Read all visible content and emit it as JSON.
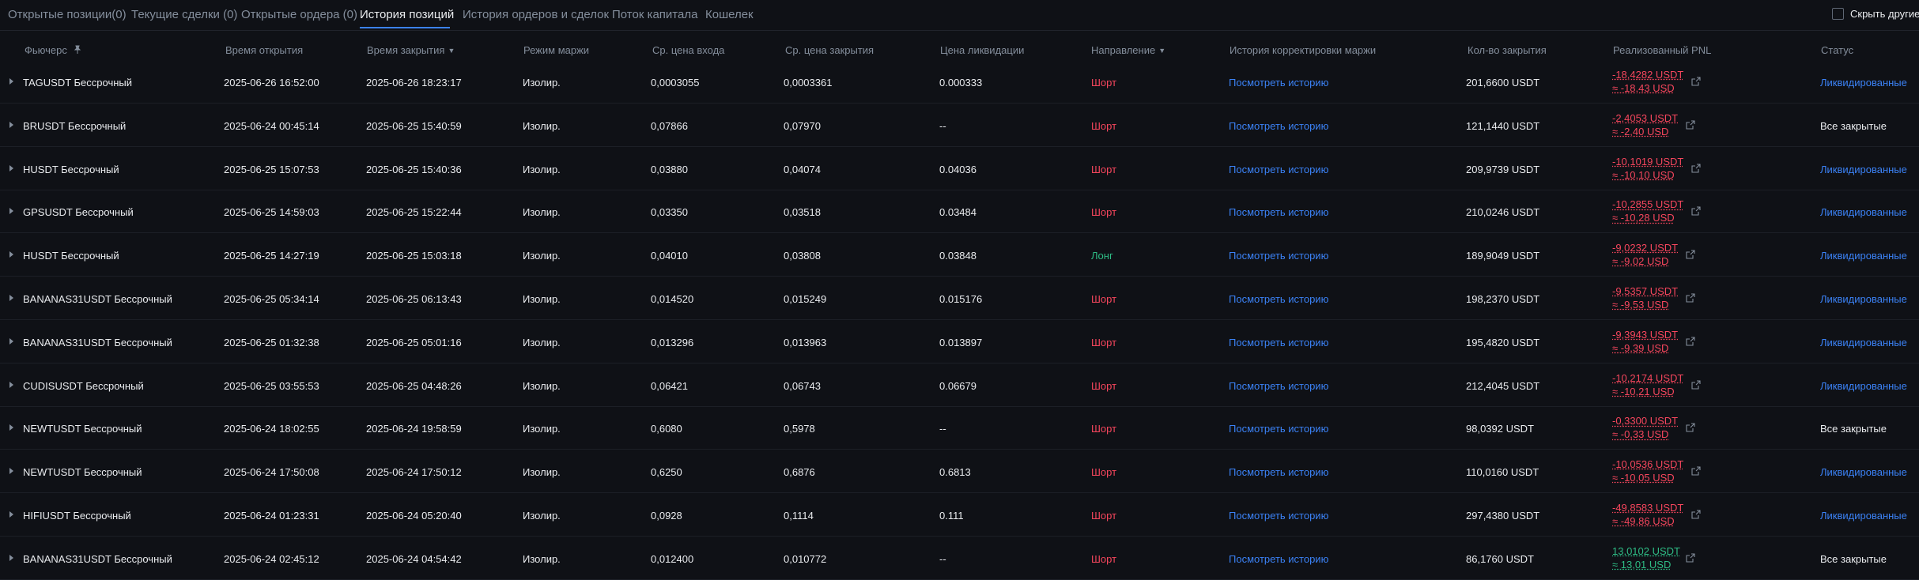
{
  "tabs": [
    {
      "label": "Открытые позиции(0)",
      "active": false
    },
    {
      "label": "Текущие сделки (0)",
      "active": false
    },
    {
      "label": "Открытые ордера (0)",
      "active": false
    },
    {
      "label": "История позиций",
      "active": true
    },
    {
      "label": "История ордеров и сделок",
      "active": false
    },
    {
      "label": "Поток капитала",
      "active": false
    },
    {
      "label": "Кошелек",
      "active": false
    }
  ],
  "hide_other_label": "Скрыть другие п",
  "columns": {
    "futures": "Фьючерс",
    "open_time": "Время открытия",
    "close_time": "Время закрытия",
    "margin_mode": "Режим маржи",
    "avg_entry": "Ср. цена входа",
    "avg_close": "Ср. цена закрытия",
    "liq_price": "Цена ликвидации",
    "direction": "Направление",
    "margin_history": "История корректировки маржи",
    "close_qty": "Кол-во закрытия",
    "realized_pnl": "Реализованный PNL",
    "status": "Статус"
  },
  "colors": {
    "red": "#f6465d",
    "green": "#2ebd85",
    "link": "#3b82f6"
  },
  "rows": [
    {
      "symbol": "TAGUSDT Бессрочный",
      "open": "2025-06-26 16:52:00",
      "close": "2025-06-26 18:23:17",
      "mode": "Изолир.",
      "entry": "0,0003055",
      "exit": "0,0003361",
      "liq": "0.000333",
      "dir": "Шорт",
      "dir_color": "red",
      "history": "Посмотреть историю",
      "qty": "201,6600 USDT",
      "pnl1": "-18,4282 USDT",
      "pnl2": "≈ -18,43 USD",
      "pnl_color": "red",
      "status": "Ликвидированные",
      "status_link": true
    },
    {
      "symbol": "BRUSDT Бессрочный",
      "open": "2025-06-24 00:45:14",
      "close": "2025-06-25 15:40:59",
      "mode": "Изолир.",
      "entry": "0,07866",
      "exit": "0,07970",
      "liq": "--",
      "dir": "Шорт",
      "dir_color": "red",
      "history": "Посмотреть историю",
      "qty": "121,1440 USDT",
      "pnl1": "-2,4053 USDT",
      "pnl2": "≈ -2,40 USD",
      "pnl_color": "red",
      "status": "Все закрытые",
      "status_link": false
    },
    {
      "symbol": "HUSDT Бессрочный",
      "open": "2025-06-25 15:07:53",
      "close": "2025-06-25 15:40:36",
      "mode": "Изолир.",
      "entry": "0,03880",
      "exit": "0,04074",
      "liq": "0.04036",
      "dir": "Шорт",
      "dir_color": "red",
      "history": "Посмотреть историю",
      "qty": "209,9739 USDT",
      "pnl1": "-10,1019 USDT",
      "pnl2": "≈ -10,10 USD",
      "pnl_color": "red",
      "status": "Ликвидированные",
      "status_link": true
    },
    {
      "symbol": "GPSUSDT Бессрочный",
      "open": "2025-06-25 14:59:03",
      "close": "2025-06-25 15:22:44",
      "mode": "Изолир.",
      "entry": "0,03350",
      "exit": "0,03518",
      "liq": "0.03484",
      "dir": "Шорт",
      "dir_color": "red",
      "history": "Посмотреть историю",
      "qty": "210,0246 USDT",
      "pnl1": "-10,2855 USDT",
      "pnl2": "≈ -10,28 USD",
      "pnl_color": "red",
      "status": "Ликвидированные",
      "status_link": true
    },
    {
      "symbol": "HUSDT Бессрочный",
      "open": "2025-06-25 14:27:19",
      "close": "2025-06-25 15:03:18",
      "mode": "Изолир.",
      "entry": "0,04010",
      "exit": "0,03808",
      "liq": "0.03848",
      "dir": "Лонг",
      "dir_color": "green",
      "history": "Посмотреть историю",
      "qty": "189,9049 USDT",
      "pnl1": "-9,0232 USDT",
      "pnl2": "≈ -9,02 USD",
      "pnl_color": "red",
      "status": "Ликвидированные",
      "status_link": true
    },
    {
      "symbol": "BANANAS31USDT Бессрочный",
      "open": "2025-06-25 05:34:14",
      "close": "2025-06-25 06:13:43",
      "mode": "Изолир.",
      "entry": "0,014520",
      "exit": "0,015249",
      "liq": "0.015176",
      "dir": "Шорт",
      "dir_color": "red",
      "history": "Посмотреть историю",
      "qty": "198,2370 USDT",
      "pnl1": "-9,5357 USDT",
      "pnl2": "≈ -9,53 USD",
      "pnl_color": "red",
      "status": "Ликвидированные",
      "status_link": true
    },
    {
      "symbol": "BANANAS31USDT Бессрочный",
      "open": "2025-06-25 01:32:38",
      "close": "2025-06-25 05:01:16",
      "mode": "Изолир.",
      "entry": "0,013296",
      "exit": "0,013963",
      "liq": "0.013897",
      "dir": "Шорт",
      "dir_color": "red",
      "history": "Посмотреть историю",
      "qty": "195,4820 USDT",
      "pnl1": "-9,3943 USDT",
      "pnl2": "≈ -9,39 USD",
      "pnl_color": "red",
      "status": "Ликвидированные",
      "status_link": true
    },
    {
      "symbol": "CUDISUSDT Бессрочный",
      "open": "2025-06-25 03:55:53",
      "close": "2025-06-25 04:48:26",
      "mode": "Изолир.",
      "entry": "0,06421",
      "exit": "0,06743",
      "liq": "0.06679",
      "dir": "Шорт",
      "dir_color": "red",
      "history": "Посмотреть историю",
      "qty": "212,4045 USDT",
      "pnl1": "-10,2174 USDT",
      "pnl2": "≈ -10,21 USD",
      "pnl_color": "red",
      "status": "Ликвидированные",
      "status_link": true
    },
    {
      "symbol": "NEWTUSDT Бессрочный",
      "open": "2025-06-24 18:02:55",
      "close": "2025-06-24 19:58:59",
      "mode": "Изолир.",
      "entry": "0,6080",
      "exit": "0,5978",
      "liq": "--",
      "dir": "Шорт",
      "dir_color": "red",
      "history": "Посмотреть историю",
      "qty": "98,0392 USDT",
      "pnl1": "-0,3300 USDT",
      "pnl2": "≈ -0,33 USD",
      "pnl_color": "red",
      "status": "Все закрытые",
      "status_link": false
    },
    {
      "symbol": "NEWTUSDT Бессрочный",
      "open": "2025-06-24 17:50:08",
      "close": "2025-06-24 17:50:12",
      "mode": "Изолир.",
      "entry": "0,6250",
      "exit": "0,6876",
      "liq": "0.6813",
      "dir": "Шорт",
      "dir_color": "red",
      "history": "Посмотреть историю",
      "qty": "110,0160 USDT",
      "pnl1": "-10,0536 USDT",
      "pnl2": "≈ -10,05 USD",
      "pnl_color": "red",
      "status": "Ликвидированные",
      "status_link": true
    },
    {
      "symbol": "HIFIUSDT Бессрочный",
      "open": "2025-06-24 01:23:31",
      "close": "2025-06-24 05:20:40",
      "mode": "Изолир.",
      "entry": "0,0928",
      "exit": "0,1114",
      "liq": "0.111",
      "dir": "Шорт",
      "dir_color": "red",
      "history": "Посмотреть историю",
      "qty": "297,4380 USDT",
      "pnl1": "-49,8583 USDT",
      "pnl2": "≈ -49,86 USD",
      "pnl_color": "red",
      "status": "Ликвидированные",
      "status_link": true
    },
    {
      "symbol": "BANANAS31USDT Бессрочный",
      "open": "2025-06-24 02:45:12",
      "close": "2025-06-24 04:54:42",
      "mode": "Изолир.",
      "entry": "0,012400",
      "exit": "0,010772",
      "liq": "--",
      "dir": "Шорт",
      "dir_color": "red",
      "history": "Посмотреть историю",
      "qty": "86,1760 USDT",
      "pnl1": "13,0102 USDT",
      "pnl2": "≈ 13,01 USD",
      "pnl_color": "green",
      "status": "Все закрытые",
      "status_link": false
    }
  ]
}
